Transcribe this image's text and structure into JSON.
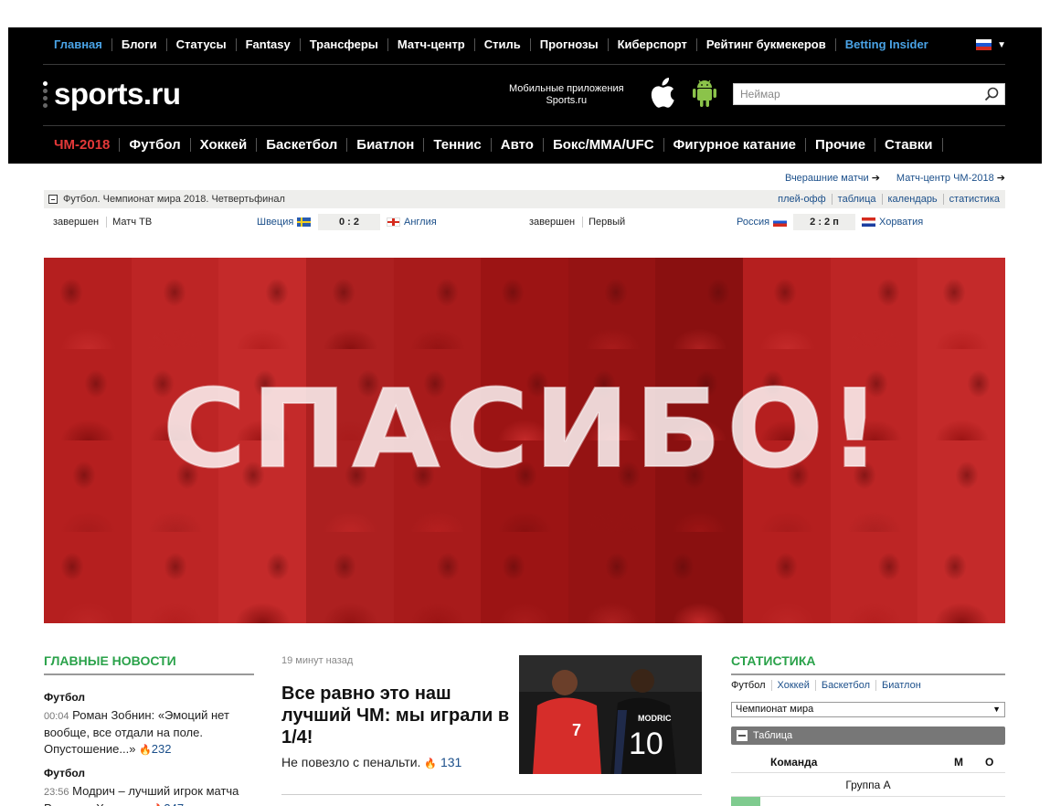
{
  "top_nav": [
    "Главная",
    "Блоги",
    "Статусы",
    "Fantasy",
    "Трансферы",
    "Матч-центр",
    "Стиль",
    "Прогнозы",
    "Киберспорт",
    "Рейтинг букмекеров",
    "Betting Insider"
  ],
  "logo": "sports.ru",
  "apps": {
    "line1": "Мобильные приложения",
    "line2": "Sports.ru"
  },
  "search": {
    "placeholder": "Неймар"
  },
  "sport_nav": [
    "ЧМ-2018",
    "Футбол",
    "Хоккей",
    "Баскетбол",
    "Биатлон",
    "Теннис",
    "Авто",
    "Бокс/MMA/UFC",
    "Фигурное катание",
    "Прочие",
    "Ставки"
  ],
  "quick_links": {
    "yesterday": "Вчерашние матчи",
    "match_center": "Матч-центр ЧМ-2018"
  },
  "tournament": {
    "title": "Футбол. Чемпионат мира 2018. Четвертьфинал",
    "links": [
      "плей-офф",
      "таблица",
      "календарь",
      "статистика"
    ]
  },
  "matches": [
    {
      "status": "завершен",
      "channel": "Матч ТВ",
      "home": "Швеция",
      "score": "0 : 2",
      "away": "Англия"
    },
    {
      "status": "завершен",
      "channel": "Первый",
      "home": "Россия",
      "score": "2 : 2 п",
      "away": "Хорватия"
    }
  ],
  "banner": {
    "text": "СПАСИБО!"
  },
  "main_news": {
    "title": "ГЛАВНЫЕ НОВОСТИ",
    "items": [
      {
        "category": "Футбол",
        "time": "00:04",
        "text": "Роман Зобнин: «Эмоций нет вообще, все отдали на поле. Опустошение...»",
        "count": "232"
      },
      {
        "category": "Футбол",
        "time": "23:56",
        "text": "Модрич – лучший игрок матча Россия – Хорватия",
        "count": "347"
      }
    ]
  },
  "lead": {
    "time": "19 минут назад",
    "title": "Все равно это наш лучший ЧМ: мы играли в 1/4!",
    "subtitle": "Не повезло с пенальти.",
    "count": "131",
    "photo_numbers": {
      "left": "7",
      "right": "10",
      "right_name": "MODRIC"
    }
  },
  "stats": {
    "title": "СТАТИСТИКА",
    "tabs": [
      "Футбол",
      "Хоккей",
      "Баскетбол",
      "Биатлон"
    ],
    "select": "Чемпионат мира",
    "table_label": "Таблица",
    "columns": {
      "team": "Команда",
      "m": "М",
      "o": "О"
    },
    "group": "Группа А"
  },
  "colors": {
    "accent_green": "#2aa24a",
    "link_blue": "#1b4f8a",
    "nav_red": "#e33838",
    "header_bg": "#000000"
  }
}
